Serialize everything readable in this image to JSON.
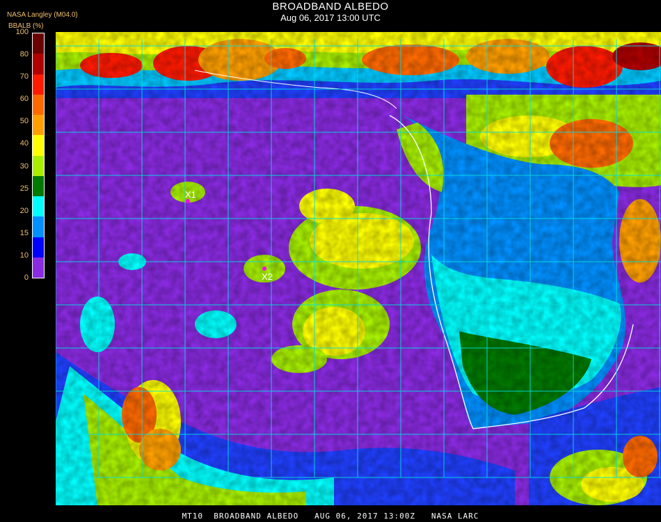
{
  "header": {
    "title": "BROADBAND ALBEDO",
    "subtitle": "Aug 06, 2017 13:00 UTC",
    "source": "NASA Langley (M04.0)",
    "unit": "BBALB (%)"
  },
  "legend": {
    "ticks": [
      "100",
      "80",
      "70",
      "60",
      "50",
      "40",
      "30",
      "25",
      "20",
      "15",
      "10",
      "0"
    ],
    "colors": [
      "#6a0000",
      "#b00000",
      "#ff1a00",
      "#ff6a00",
      "#ffa000",
      "#ffff00",
      "#a8f000",
      "#007a00",
      "#00ffff",
      "#0090ff",
      "#0000ff",
      "#8a2be2"
    ]
  },
  "markers": [
    {
      "label": "X1"
    },
    {
      "label": "X2"
    }
  ],
  "footer": "MT10  BROADBAND ALBEDO   AUG 06, 2017 13:00Z   NASA LARC"
}
